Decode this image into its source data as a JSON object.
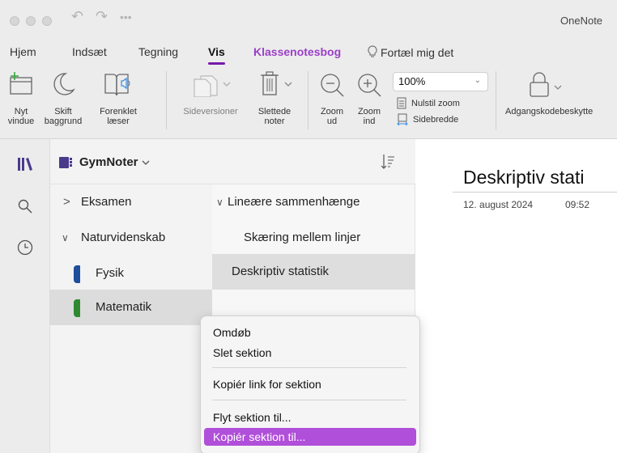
{
  "app": {
    "title": "OneNote"
  },
  "ribbon_tabs": [
    {
      "label": "Hjem"
    },
    {
      "label": "Indsæt"
    },
    {
      "label": "Tegning"
    },
    {
      "label": "Vis"
    },
    {
      "label": "Klassenotesbog"
    },
    {
      "label": "Fortæl mig det"
    }
  ],
  "active_tab": "Vis",
  "ribbon": {
    "new_window": [
      "Nyt",
      "vindue"
    ],
    "switch_bg": [
      "Skift",
      "baggrund"
    ],
    "reader": [
      "Forenklet",
      "læser"
    ],
    "versions": [
      "Sideversioner"
    ],
    "deleted": [
      "Slettede",
      "noter"
    ],
    "zoom_out": [
      "Zoom",
      "ud"
    ],
    "zoom_in": [
      "Zoom",
      "ind"
    ],
    "zoom_value": "100%",
    "reset_zoom": "Nulstil zoom",
    "page_width": "Sidebredde",
    "password": "Adgangskodebeskytte"
  },
  "notebook": {
    "name": "GymNoter"
  },
  "sections": [
    {
      "label": "Eksamen",
      "chevron": ">"
    },
    {
      "label": "Naturvidenskab",
      "chevron": "∨"
    },
    {
      "label": "Fysik",
      "color": "#1f4e9c"
    },
    {
      "label": "Matematik",
      "color": "#2f8a2f"
    }
  ],
  "pages": [
    {
      "label": "Lineære sammenhænge",
      "chevron": "∨"
    },
    {
      "label": "Skæring mellem linjer"
    },
    {
      "label": "Deskriptiv statistik"
    }
  ],
  "page": {
    "title": "Deskriptiv stati",
    "date": "12. august 2024",
    "time": "09:52"
  },
  "context_menu": [
    {
      "label": "Omdøb"
    },
    {
      "label": "Slet sektion"
    },
    {
      "label": "Kopiér link for sektion"
    },
    {
      "label": "Flyt sektion til..."
    },
    {
      "label": "Kopiér sektion til..."
    }
  ],
  "colors": {
    "accent": "#7719aa",
    "highlight": "#b04fd9",
    "tab_purple": "#9b3fc8"
  }
}
